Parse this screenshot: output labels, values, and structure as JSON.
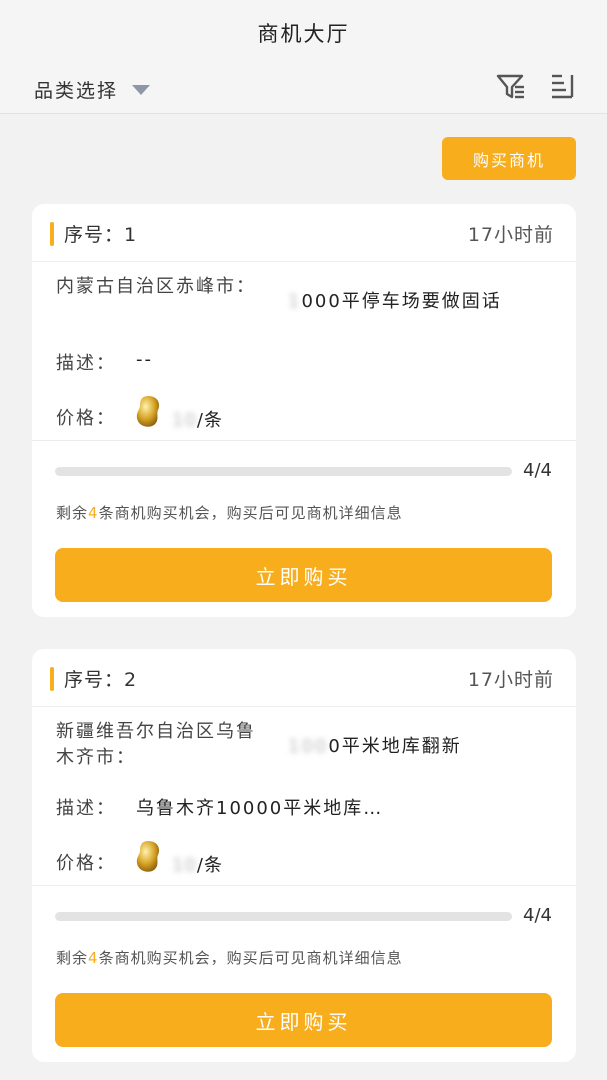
{
  "header": {
    "title": "商机大厅",
    "category_label": "品类选择",
    "filter_icon": "filter-icon",
    "sort_icon": "sort-list-icon"
  },
  "buy_leads_button": "购买商机",
  "colors": {
    "accent": "#f7ad1c",
    "background": "#f2f2f2",
    "card": "#ffffff"
  },
  "cards": [
    {
      "serial": "序号：1",
      "time_ago": "17小时前",
      "region": "内蒙古自治区赤峰市：",
      "headline": "000平停车场要做固话",
      "desc_label": "描述：",
      "desc_value": "--",
      "price_label": "价格：",
      "price_value": "/条",
      "progress_text": "4/4",
      "progress_fraction": 1.0,
      "remain_prefix": "剩余",
      "remain_count": "4",
      "remain_suffix": "条商机购买机会，购买后可见商机详细信息",
      "buy_button": "立即购买"
    },
    {
      "serial": "序号：2",
      "time_ago": "17小时前",
      "region": "新疆维吾尔自治区乌鲁木齐市：",
      "headline": "0平米地库翻新",
      "desc_label": "描述：",
      "desc_value": "乌鲁木齐10000平米地库…",
      "price_label": "价格：",
      "price_value": "/条",
      "progress_text": "4/4",
      "progress_fraction": 1.0,
      "remain_prefix": "剩余",
      "remain_count": "4",
      "remain_suffix": "条商机购买机会，购买后可见商机详细信息",
      "buy_button": "立即购买"
    }
  ]
}
